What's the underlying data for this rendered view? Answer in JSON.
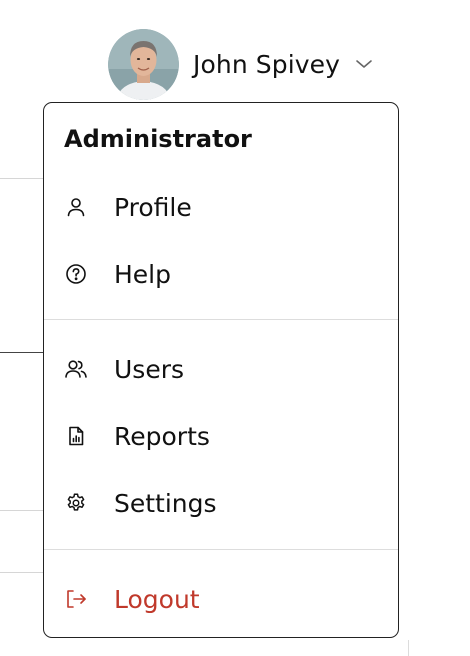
{
  "user": {
    "name": "John Spivey"
  },
  "menu": {
    "heading": "Administrator",
    "items_top": [
      {
        "label": "Profile",
        "icon": "user-icon"
      },
      {
        "label": "Help",
        "icon": "help-circle-icon"
      }
    ],
    "items_admin": [
      {
        "label": "Users",
        "icon": "users-icon"
      },
      {
        "label": "Reports",
        "icon": "report-icon"
      },
      {
        "label": "Settings",
        "icon": "gear-icon"
      }
    ],
    "logout": {
      "label": "Logout",
      "icon": "logout-icon",
      "color": "#c0392b"
    }
  },
  "colors": {
    "text": "#111111",
    "danger": "#c0392b",
    "border": "#222222",
    "divider": "#dddddd"
  }
}
